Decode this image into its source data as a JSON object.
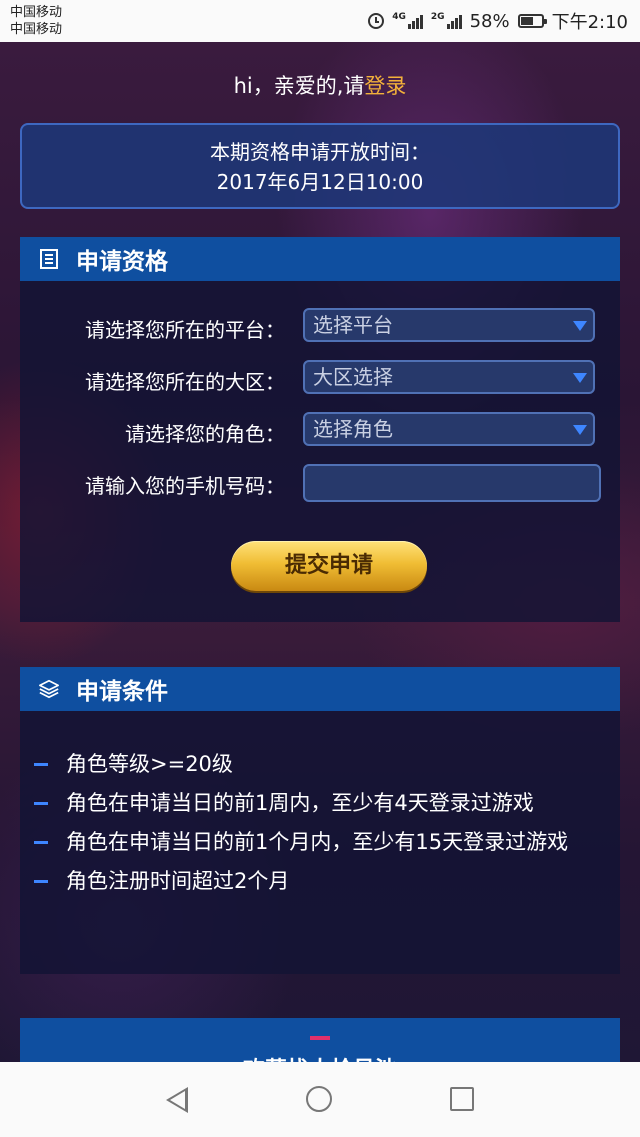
{
  "status_bar": {
    "carrier1": "中国移动",
    "carrier2": "中国移动",
    "net1": "4G",
    "net2": "2G",
    "battery_percent": "58%",
    "battery_level": 0.58,
    "time": "下午2:10"
  },
  "greeting": {
    "prefix": "hi，亲爱的,请",
    "login_link": "登录"
  },
  "open_time": {
    "title": "本期资格申请开放时间：",
    "value": "2017年6月12日10:00"
  },
  "apply_panel": {
    "title": "申请资格",
    "rows": [
      {
        "label": "请选择您所在的平台：",
        "value": "选择平台"
      },
      {
        "label": "请选择您所在的大区：",
        "value": "大区选择"
      },
      {
        "label": "请选择您的角色：",
        "value": "选择角色"
      },
      {
        "label": "请输入您的手机号码：",
        "value": ""
      }
    ],
    "submit_label": "提交申请"
  },
  "conditions_panel": {
    "title": "申请条件",
    "items": [
      "角色等级>=20级",
      "角色在申请当日的前1周内，至少有4天登录过游戏",
      "角色在申请当日的前1个月内，至少有15天登录过游戏",
      "角色注册时间超过2个月"
    ]
  },
  "third_section": {
    "title": "欢募找大拾号池"
  },
  "colors": {
    "accent_blue": "#0f4fa0",
    "login_orange": "#f3b13a",
    "button_gold": "#f0bd34"
  },
  "icons": [
    "alarm-icon",
    "signal-icon",
    "battery-icon",
    "document-icon",
    "layers-icon",
    "back-icon",
    "home-icon",
    "recent-apps-icon"
  ]
}
